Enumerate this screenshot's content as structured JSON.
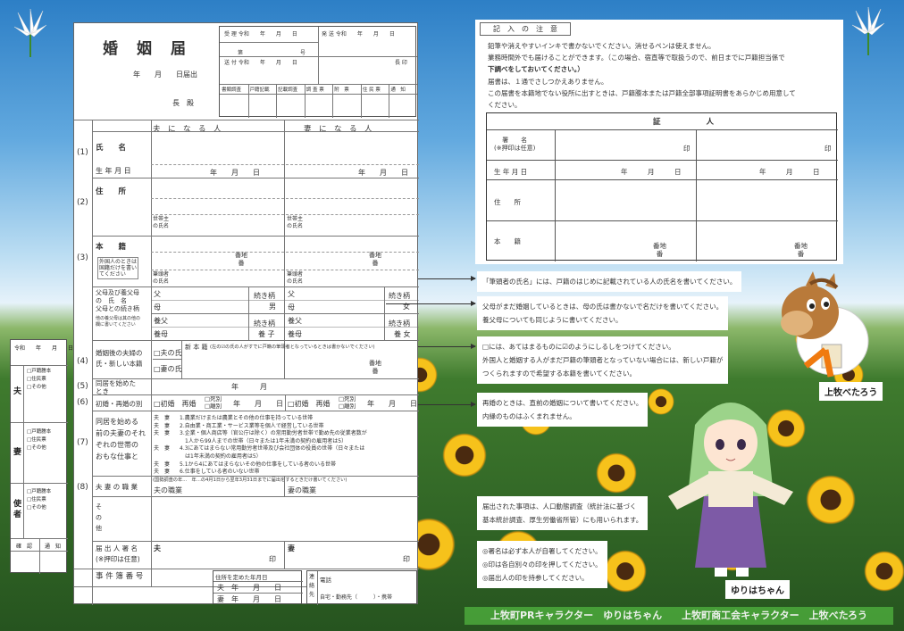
{
  "form": {
    "title": "婚　姻　届",
    "date_line": "年　　月　　日届出",
    "addressee": "長　殿",
    "office": {
      "received": "受 理 令和　　年　　月　　日",
      "sent": "発 送 令和　　年　　月　　日",
      "dai": "第",
      "go": "号",
      "sent2": "送 付 令和　　年　　月　　日",
      "chief_seal": "長 印",
      "checks": [
        "書類調査",
        "戸籍記載",
        "記載調査",
        "調 査 票",
        "附　票",
        "住 民 票",
        "通　知"
      ]
    },
    "col_husband": "夫　に　な　る　人",
    "col_wife": "妻　に　な　る　人",
    "rows": {
      "n1": "(1)",
      "n2": "(2)",
      "n3": "(3)",
      "n4": "(4)",
      "n5": "(5)",
      "n6": "(6)",
      "n7": "(7)",
      "n8": "(8)",
      "name": "氏　　名",
      "birth": "生 年 月 日",
      "ymd": "年　　月　　日",
      "address": "住　　所",
      "household_head": "世帯主\nの氏名",
      "honseki": "本　　籍",
      "foreign_note": "外国人のときは\n国籍だけを書い\nてください",
      "banchi": "番地\n番",
      "hittousha": "筆頭者\nの氏名",
      "parents": "父母及び養父母\nの　氏　名\n父母との続き柄",
      "parents_note": "他の養父母は其の他の\n欄に書いてください",
      "father": "父",
      "mother": "母",
      "adopt_father": "養父",
      "adopt_mother": "養母",
      "relation": "続き柄",
      "male": "男",
      "female": "女",
      "adopt_son": "養 子",
      "adopt_daughter": "養 女",
      "after_name": "婚姻後の夫婦の\n氏・新しい本籍",
      "husband_name_opt": "□夫の氏",
      "wife_name_opt": "□妻の氏",
      "new_honseki": "新 本 籍",
      "new_honseki_note": "(左の☑の氏の人がすでに戸籍の筆頭者となっているときは書かないでください)",
      "cohabit": "同居を始めた\nとき",
      "cohabit_ym": "年　　　月",
      "first_or_re": "初婚・再婚の別",
      "first_opt": "□初婚　再婚",
      "death_opt": "□死別\n□離別",
      "occupation_head": "同居を始める\n前の夫妻のそれ\nぞれの世帯の\nおもな仕事と",
      "hw": "夫　妻",
      "jobs": [
        "1.農業だけまたは農業とその他の仕事を持っている世帯",
        "2.自由業・商工業・サービス業等を個人で経営している世帯",
        "3.企業・個人商店等（官公庁は除く）の常用勤労者世帯で勤め先の従業者数が",
        "　1人から99人までの世帯（日々または1年未満の契約の雇用者は5）",
        "4.3にあてはまらない常用勤労者世帯及び会社団体の役員の世帯（日々または",
        "　は1年未満の契約の雇用者は5）",
        "5.1から4にあてはまらないその他の仕事をしている者のいる世帯",
        "6.仕事をしている者のいない世帯"
      ],
      "census_note": "(国勢調査の年…　年…の4月1日から翌年3月31日までに届出をするときだけ書いてください)",
      "job_label": "夫 妻 の 職 業",
      "husband_job": "夫の職業",
      "wife_job": "妻の職業",
      "other": "そ\nの\n他",
      "signature": "届 出 人 署 名\n(※押印は任意)",
      "sig_h": "夫",
      "sig_w": "妻",
      "seal": "印",
      "case_no": "事 件 簿 番 号",
      "live_start": "住所を定めた年月日",
      "husband": "夫",
      "wife": "妻",
      "contact": "連\n絡\n先",
      "phone": "電話",
      "phone_types": "自宅・勤務先（　　　）・携帯"
    }
  },
  "mini": {
    "header": "令和　　年　　月　　日",
    "husband": "夫",
    "wife": "妻",
    "messenger": "使\n者",
    "opts": [
      "□戸籍謄本",
      "□住民票",
      "□その他"
    ],
    "confirm": "確　認",
    "notify": "通　知"
  },
  "notice": {
    "title": "記　入　の　注　意",
    "lines": [
      "鉛筆や消えやすいインキで書かないでください。消せるペンは使えません。",
      "業務時間外でも届けることができます。（この場合、宿直等で取扱うので、前日までに戸籍担当係で",
      "下調べをしておいてください。）",
      "届書は、１通でさしつかえありません。",
      "この届書を本籍地でない役所に出すときは、戸籍謄本または戸籍全部事項証明書をあらかじめ用意して",
      "ください。"
    ],
    "witness_title": "証　　　　　　人",
    "w_sign": "署　　名\n(※押印は任意)",
    "w_birth": "生 年 月 日",
    "w_address": "住　　所",
    "w_honseki": "本　　籍",
    "w_ymd": "年　　　月　　　日",
    "w_seal": "印",
    "w_banchi": "番地\n番"
  },
  "notes": [
    "「筆頭者の氏名」には、戸籍のはじめに記載されている人の氏名を書いてください。",
    "父母がまだ婚姻しているときは、母の氏は書かないで名だけを書いてください。\n養父母についても同じように書いてください。",
    "□には、あてはまるものに☑のようにしるしをつけてください。\n外国人と婚姻する人がまだ戸籍の筆頭者となっていない場合には、新しい戸籍が\nつくられますので希望する本籍を書いてください。",
    "再婚のときは、直前の婚姻について書いてください。\n内縁のものはふくまれません。",
    "届出された事項は、人口動態調査（統計法に基づく\n基本統計調査、厚生労働省所管）にも用いられます。",
    "◎署名は必ず本人が自署してください。\n◎印は各自別々の印を押してください。\n◎届出人の印を持参してください。"
  ],
  "characters": {
    "horse": "上牧べたろう",
    "girl": "ゆりはちゃん"
  },
  "footer": "上牧町PRキャラクター　ゆりはちゃん　　上牧町商工会キャラクター　上牧べたろう",
  "colors": {
    "sky": "#3d8fd4",
    "field": "#2f6a24",
    "sunflower": "#f6c21b",
    "footer": "#49a33a"
  }
}
